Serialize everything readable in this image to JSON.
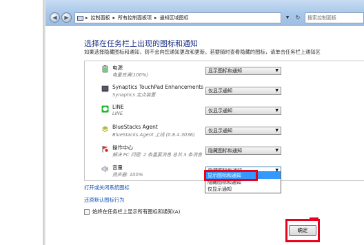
{
  "address_bar": {
    "segments": [
      "控制面板",
      "所有控制面板项",
      "通知区域图标"
    ],
    "search_placeholder": "搜索控制面板"
  },
  "heading": "选择在任务栏上出现的图标和通知",
  "description": "如果选择隐藏图标和通知，则不会向您通知更改和更新。若要随时查看隐藏的图标，请单击任务栏上通知区",
  "icons": [
    {
      "name": "电源",
      "sub": "电量充满(100%)",
      "behavior": "显示图标和通知",
      "icon": "power-icon"
    },
    {
      "name": "Synaptics TouchPad Enhancements",
      "sub": "Synaptics 定点装置",
      "behavior": "仅显示通知",
      "icon": "touchpad-icon"
    },
    {
      "name": "LINE",
      "sub": "LINE",
      "behavior": "仅显示通知",
      "icon": "line-icon"
    },
    {
      "name": "BlueStacks Agent",
      "sub": "BlueStacks Agent 上线 (0.8.4.3036)",
      "behavior": "仅显示通知",
      "icon": "bluestacks-icon"
    },
    {
      "name": "操作中心",
      "sub": "解决 PC 问题: 2 条重要消息 总共 3 条消息",
      "behavior": "隐藏图标和通知",
      "icon": "action-center-flag-icon"
    },
    {
      "name": "音量",
      "sub": "扬声器: 100%",
      "behavior": "隐藏图标和通知",
      "icon": "speaker-icon"
    }
  ],
  "dropdown_options": [
    "显示图标和通知",
    "隐藏图标和通知",
    "仅显示通知"
  ],
  "dropdown_highlighted": "显示图标和通知",
  "links": {
    "system_icons": "打开或关闭系统图标",
    "restore_default": "还原默认图标行为"
  },
  "always_show_label": "始终在任务栏上显示所有图标和通知(A)",
  "ok_label": "确定",
  "colors": {
    "highlight": "#3399ff",
    "annotation_red": "#e8001c",
    "link": "#1654b4",
    "heading": "#1e3287"
  }
}
